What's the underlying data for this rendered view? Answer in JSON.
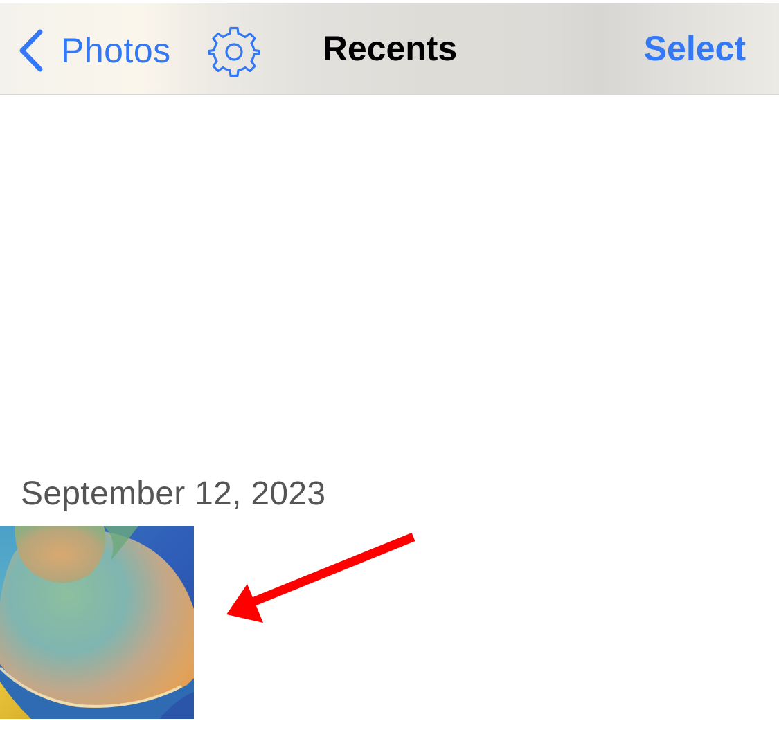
{
  "navbar": {
    "back_label": "Photos",
    "title": "Recents",
    "select_label": "Select",
    "back_icon": "chevron-left-icon",
    "settings_icon": "gear-icon"
  },
  "gallery": {
    "section_date": "September 12, 2023",
    "items": [
      {
        "kind": "photo",
        "thumbnail": "abstract-wallpaper"
      }
    ]
  },
  "annotation": {
    "type": "arrow",
    "color": "#ff0000"
  },
  "colors": {
    "accent": "#3478f6",
    "title": "#000000",
    "section_text": "#555555"
  }
}
